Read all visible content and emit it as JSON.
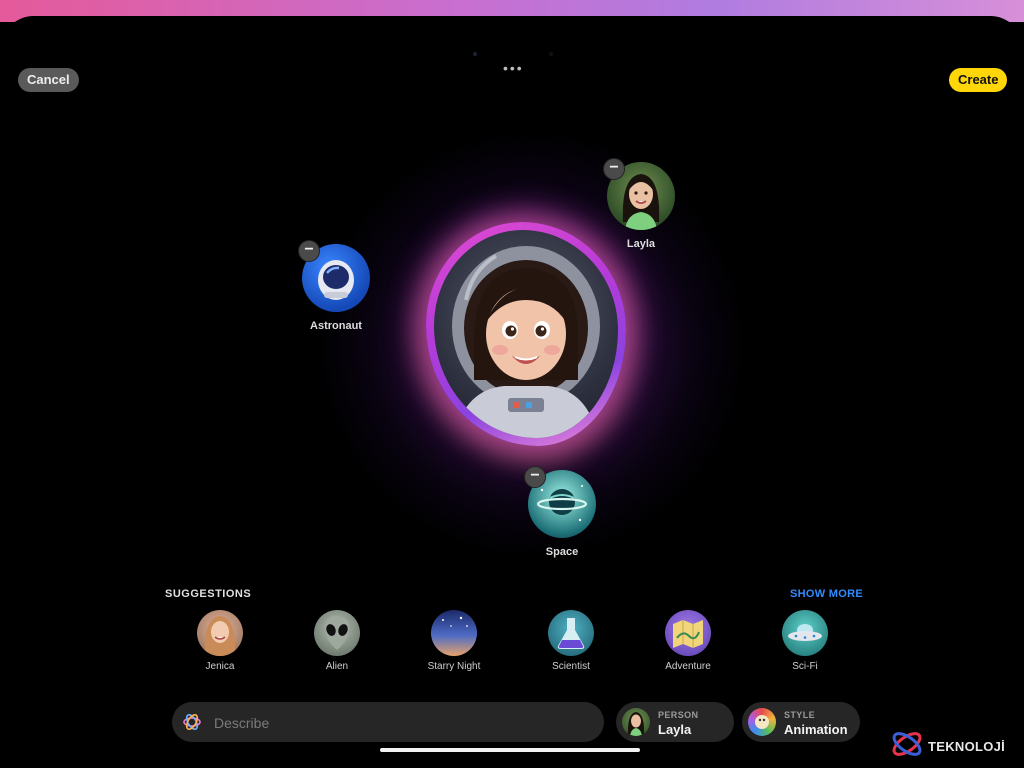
{
  "window": {
    "cancel_label": "Cancel",
    "create_label": "Create",
    "more_glyph": "•••"
  },
  "canvas": {
    "center_image": "astronaut-woman-avatar",
    "concepts": [
      {
        "label": "Astronaut",
        "icon": "astronaut-helmet-icon",
        "removable": true
      },
      {
        "label": "Layla",
        "icon": "person-photo-layla",
        "removable": true
      },
      {
        "label": "Space",
        "icon": "planet-icon",
        "removable": true
      }
    ],
    "remove_glyph": "−"
  },
  "suggestions": {
    "title": "SUGGESTIONS",
    "show_more": "SHOW MORE",
    "items": [
      {
        "label": "Jenica",
        "icon": "person-photo-jenica"
      },
      {
        "label": "Alien",
        "icon": "alien-icon"
      },
      {
        "label": "Starry Night",
        "icon": "starry-night-icon"
      },
      {
        "label": "Scientist",
        "icon": "flask-icon"
      },
      {
        "label": "Adventure",
        "icon": "map-icon"
      },
      {
        "label": "Sci-Fi",
        "icon": "ufo-icon"
      }
    ]
  },
  "bottom_bar": {
    "describe_placeholder": "Describe",
    "person": {
      "key": "PERSON",
      "value": "Layla"
    },
    "style": {
      "key": "STYLE",
      "value": "Animation"
    }
  },
  "watermark": {
    "text": "TEKNOLOJİ"
  },
  "colors": {
    "create_button": "#ffd60a",
    "show_more": "#2f8cff",
    "glow": "#c04bd6"
  }
}
